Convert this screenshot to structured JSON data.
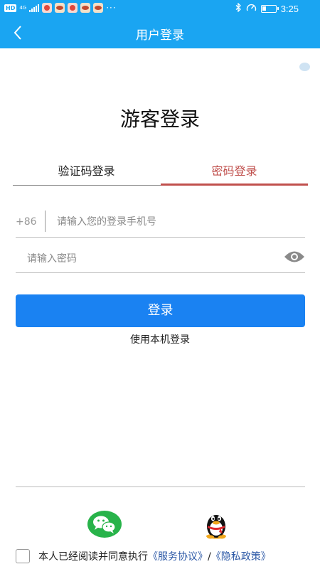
{
  "status_bar": {
    "hd_badge": "HD",
    "network": "4G",
    "time": "3:25",
    "more": "···"
  },
  "header": {
    "title": "用户登录"
  },
  "page": {
    "heading": "游客登录"
  },
  "tabs": [
    {
      "label": "验证码登录",
      "active": false
    },
    {
      "label": "密码登录",
      "active": true
    }
  ],
  "form": {
    "country_code": "+86",
    "phone_placeholder": "请输入您的登录手机号",
    "phone_value": "",
    "password_placeholder": "请输入密码",
    "password_value": "",
    "login_button": "登录",
    "local_login_link": "使用本机登录"
  },
  "social": {
    "wechat": "wechat-icon",
    "qq": "qq-icon"
  },
  "agreement": {
    "text": "本人已经阅读并同意执行",
    "service_link": "《服务协议》",
    "separator": "/",
    "privacy_link": "《隐私政策》",
    "checked": false
  },
  "colors": {
    "header_bg": "#1aa5f2",
    "active_tab": "#c0504d",
    "button_bg": "#1a82f2",
    "link": "#2e5aa7"
  }
}
